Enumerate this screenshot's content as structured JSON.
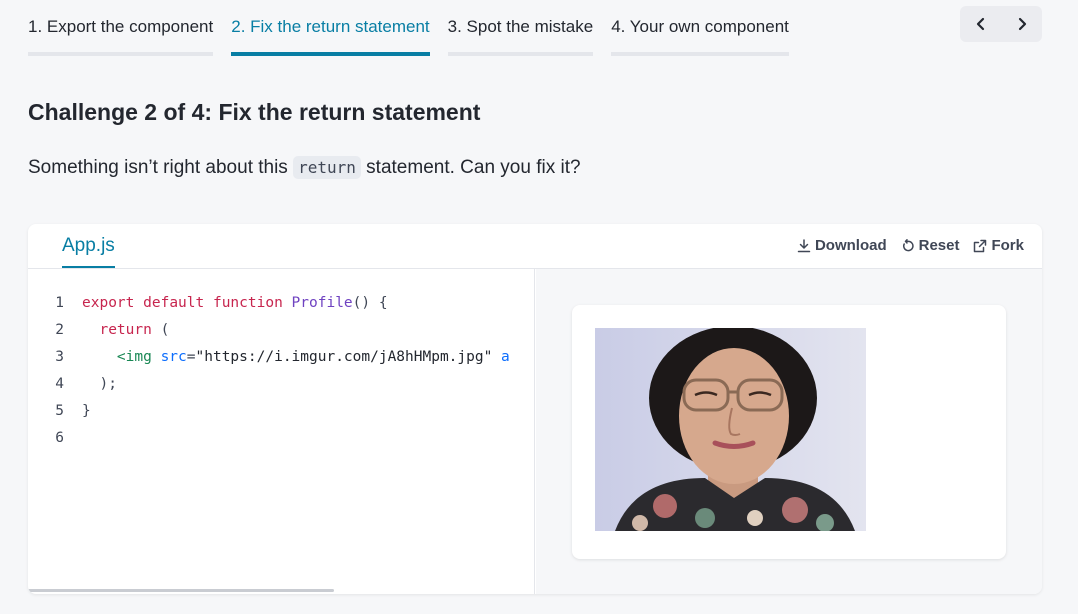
{
  "tabs": [
    {
      "label": "1. Export the component",
      "active": false
    },
    {
      "label": "2. Fix the return statement",
      "active": true
    },
    {
      "label": "3. Spot the mistake",
      "active": false
    },
    {
      "label": "4. Your own component",
      "active": false
    }
  ],
  "nav": {
    "prev_icon": "chevron-left-icon",
    "next_icon": "chevron-right-icon"
  },
  "challenge": {
    "prefix": "Challenge 2 of 4:",
    "title": "Fix the return statement",
    "desc_before": "Something isn’t right about this",
    "desc_code": "return",
    "desc_after": "statement. Can you fix it?"
  },
  "sandbox": {
    "file_tab": "App.js",
    "actions": {
      "download": "Download",
      "reset": "Reset",
      "fork": "Fork"
    },
    "line_numbers": [
      "1",
      "2",
      "3",
      "4",
      "5",
      "6"
    ],
    "code_lines": [
      [
        "export",
        " ",
        "default",
        " ",
        "function",
        " ",
        "Profile",
        "() {"
      ],
      [
        "  ",
        "return",
        " ("
      ],
      [
        "    ",
        "<img",
        " ",
        "src",
        "=",
        "\"https://i.imgur.com/jA8hHMpm.jpg\"",
        " a"
      ],
      [
        "  );"
      ],
      [
        "}"
      ],
      [
        ""
      ]
    ]
  },
  "preview": {
    "image_alt": "portrait photo"
  },
  "colors": {
    "accent": "#087ea4",
    "text": "#23272f"
  }
}
